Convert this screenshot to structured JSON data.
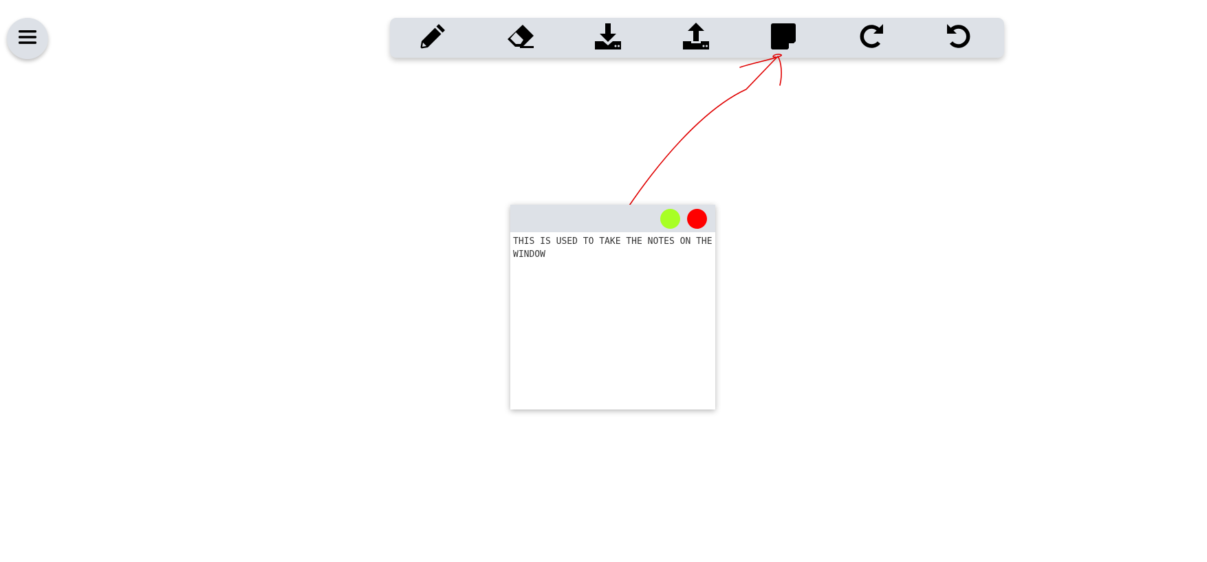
{
  "menu": {
    "icon": "hamburger-menu-icon"
  },
  "toolbar": {
    "tools": [
      {
        "name": "pencil",
        "icon": "pencil-icon"
      },
      {
        "name": "eraser",
        "icon": "eraser-icon"
      },
      {
        "name": "download",
        "icon": "download-icon"
      },
      {
        "name": "upload",
        "icon": "upload-icon"
      },
      {
        "name": "sticky-note",
        "icon": "sticky-note-icon"
      },
      {
        "name": "redo",
        "icon": "redo-icon"
      },
      {
        "name": "undo",
        "icon": "undo-icon"
      }
    ]
  },
  "annotation": {
    "color": "#e00000",
    "type": "freehand-arrow"
  },
  "note": {
    "text": "THIS IS USED TO TAKE THE NOTES ON THE WINDOW",
    "header_color": "#dde1e7",
    "green_button_color": "#a8ff24",
    "red_button_color": "#ff0000"
  },
  "colors": {
    "toolbar_bg": "#dde1e7",
    "icon": "#000000",
    "canvas": "#ffffff"
  }
}
